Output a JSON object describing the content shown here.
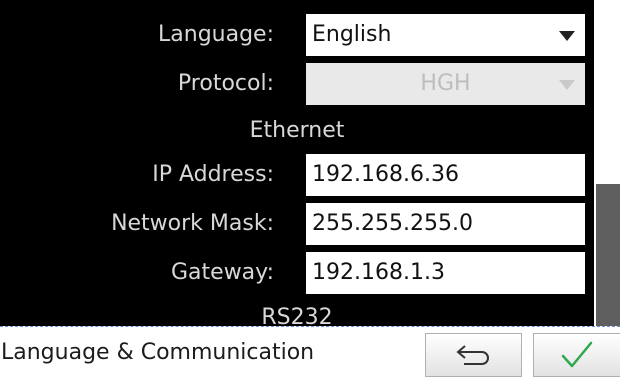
{
  "settings": {
    "language": {
      "label": "Language:",
      "value": "English"
    },
    "protocol": {
      "label": "Protocol:",
      "value": "HGH",
      "disabled": true
    },
    "ethernet_heading": "Ethernet",
    "ip_address": {
      "label": "IP Address:",
      "value": "192.168.6.36"
    },
    "network_mask": {
      "label": "Network Mask:",
      "value": "255.255.255.0"
    },
    "gateway": {
      "label": "Gateway:",
      "value": "192.168.1.3"
    },
    "rs232_heading": "RS232"
  },
  "scrollbar": {
    "position_fraction": 0.56
  },
  "footer": {
    "title": "Language & Communication",
    "back_icon": "undo-arrow-icon",
    "confirm_icon": "checkmark-icon"
  },
  "colors": {
    "background": "#000000",
    "label_text": "#d8d8d8",
    "confirm_check": "#2fa84f",
    "scroll_thumb": "#5f5f5f"
  }
}
